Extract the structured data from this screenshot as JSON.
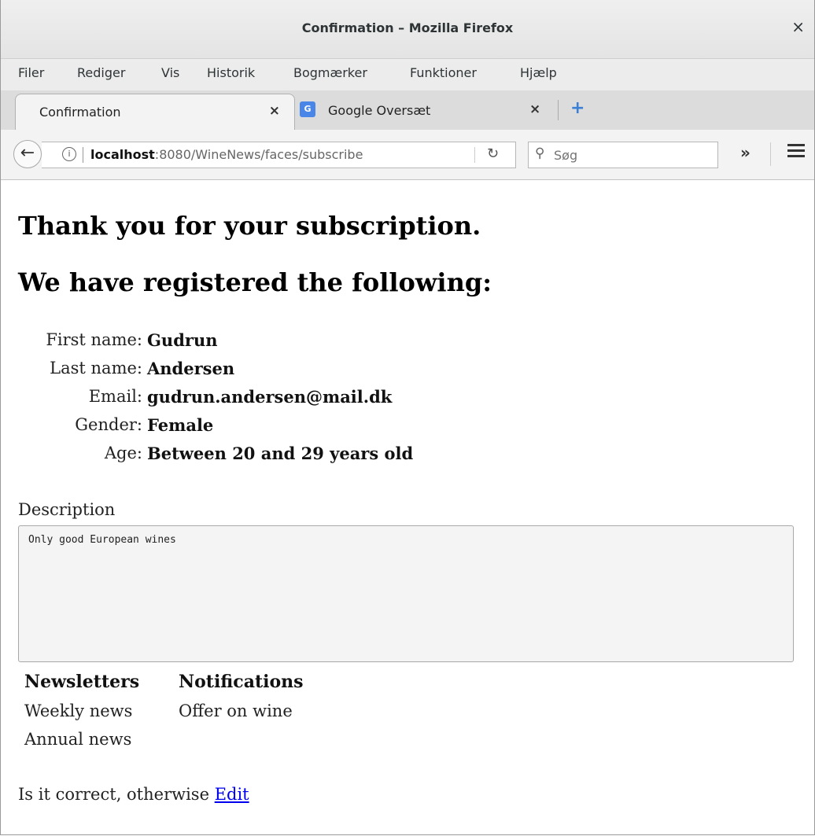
{
  "window": {
    "title": "Confirmation – Mozilla Firefox",
    "close_glyph": "×"
  },
  "menubar": {
    "items": [
      "Filer",
      "Rediger",
      "Vis",
      "Historik",
      "Bogmærker",
      "Funktioner",
      "Hjælp"
    ]
  },
  "tabs": {
    "active_label": "Confirmation",
    "second_label": "Google Oversæt",
    "close_glyph": "×",
    "new_tab_glyph": "+"
  },
  "navbar": {
    "url_host": "localhost",
    "url_rest": ":8080/WineNews/faces/subscribe",
    "search_placeholder": "Søg",
    "overflow_glyph": "»"
  },
  "page": {
    "heading1": "Thank you for your subscription.",
    "heading2": "We have registered the following:",
    "fields": [
      {
        "label": "First name:",
        "value": "Gudrun"
      },
      {
        "label": "Last name:",
        "value": "Andersen"
      },
      {
        "label": "Email:",
        "value": "gudrun.andersen@mail.dk"
      },
      {
        "label": "Gender:",
        "value": "Female"
      },
      {
        "label": "Age:",
        "value": "Between 20 and 29 years old"
      }
    ],
    "description_label": "Description",
    "description_value": "Only good European wines",
    "newsletters_header": "Newsletters",
    "newsletters": [
      "Weekly news",
      "Annual news"
    ],
    "notifications_header": "Notifications",
    "notifications": [
      "Offer on wine"
    ],
    "confirm_text": "Is it correct, otherwise ",
    "edit_link": "Edit"
  }
}
